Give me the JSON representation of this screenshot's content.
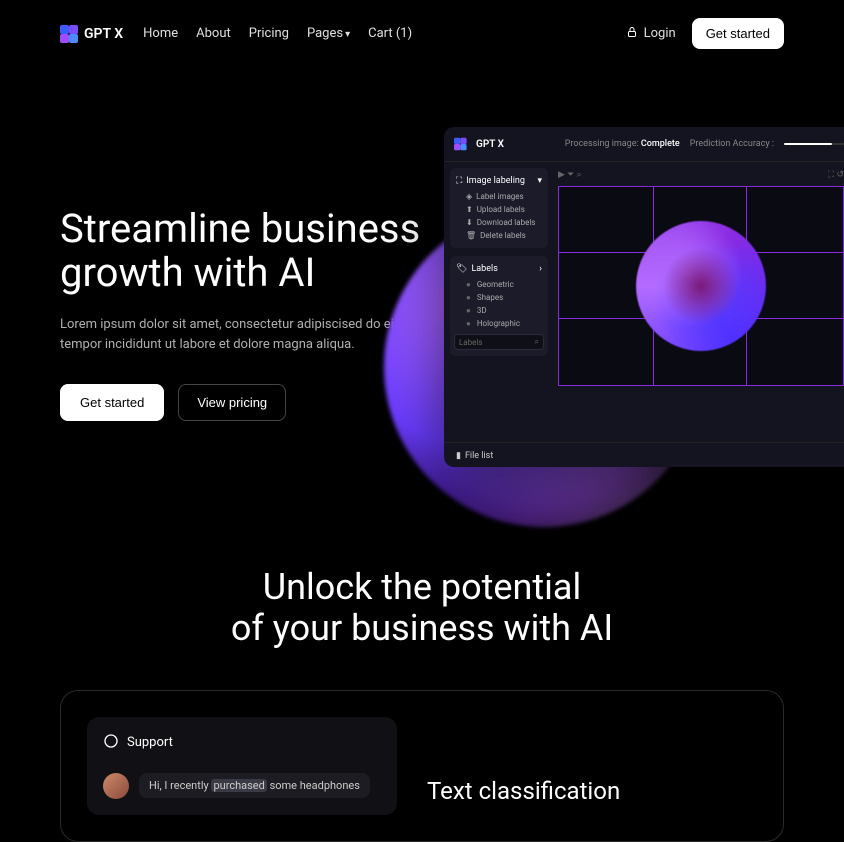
{
  "brand": "GPT X",
  "nav": {
    "links": [
      "Home",
      "About",
      "Pricing",
      "Pages"
    ],
    "cart": "Cart (1)",
    "login": "Login",
    "cta": "Get started"
  },
  "hero": {
    "title": "Streamline business growth with AI",
    "subtitle": "Lorem ipsum dolor sit amet, consectetur adipiscised do eiusmod tempor incididunt ut labore et dolore magna aliqua.",
    "primary": "Get started",
    "secondary": "View pricing"
  },
  "app": {
    "brand": "GPT X",
    "processing_label": "Processing image:",
    "processing_status": "Complete",
    "accuracy_label": "Prediction Accuracy :",
    "sidebar1": {
      "title": "Image labeling",
      "items": [
        "Label images",
        "Upload labels",
        "Download labels",
        "Delete labels"
      ]
    },
    "sidebar2": {
      "title": "Labels",
      "items": [
        "Geometric",
        "Shapes",
        "3D",
        "Holographic"
      ],
      "search_placeholder": "Labels"
    },
    "filelist": "File list"
  },
  "section2": {
    "heading_l1": "Unlock the potential",
    "heading_l2": "of your business with AI"
  },
  "card": {
    "support_title": "Support",
    "msg_pre": "Hi, I recently ",
    "msg_hl": "purchased",
    "msg_post": " some headphones",
    "right_title": "Text classification"
  }
}
